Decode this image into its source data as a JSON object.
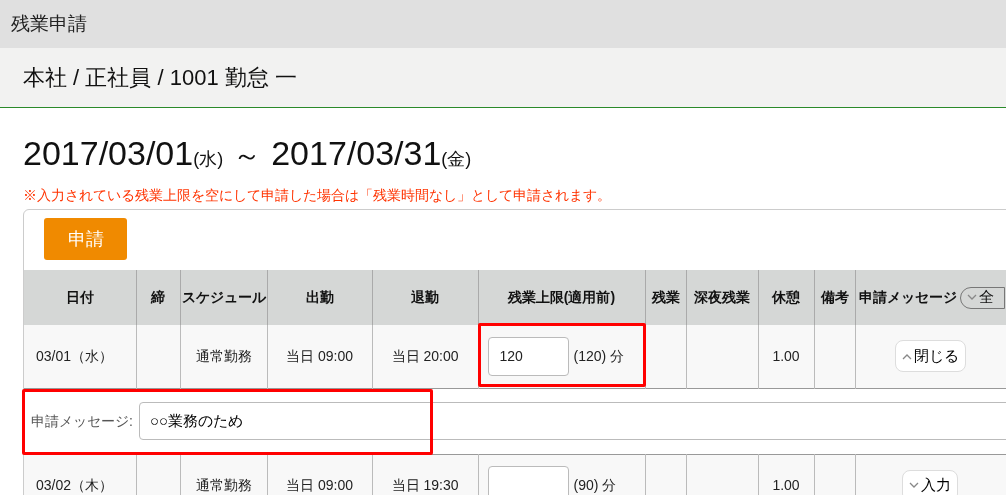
{
  "window": {
    "title": "残業申請"
  },
  "breadcrumb": "本社 / 正社員 / 1001 勤怠 一",
  "period": {
    "start": "2017/03/01",
    "start_day": "(水)",
    "separator": "～",
    "end": "2017/03/31",
    "end_day": "(金)"
  },
  "notice": "※入力されている残業上限を空にして申請した場合は「残業時間なし」として申請されます。",
  "apply_button": "申請",
  "table": {
    "columns": [
      "日付",
      "締",
      "スケジュール",
      "出勤",
      "退勤",
      "残業上限(適用前)",
      "残業",
      "深夜残業",
      "休憩",
      "備考",
      "申請メッセージ"
    ],
    "toggle_all": "全",
    "rows": [
      {
        "date": "03/01（水）",
        "schedule": "通常勤務",
        "clock_in": "当日 09:00",
        "clock_out": "当日 20:00",
        "limit_value": "120",
        "limit_default": "(120) 分",
        "break": "1.00",
        "message_button": "閉じる",
        "expanded": true,
        "highlighted": true,
        "message": {
          "label": "申請メッセージ:",
          "value": "○○業務のため",
          "highlighted": true
        }
      },
      {
        "date": "03/02（木）",
        "schedule": "通常勤務",
        "clock_in": "当日 09:00",
        "clock_out": "当日 19:30",
        "limit_default": "(90) 分",
        "break": "1.00",
        "message_button": "入力",
        "expanded": false,
        "highlighted": false
      }
    ]
  }
}
